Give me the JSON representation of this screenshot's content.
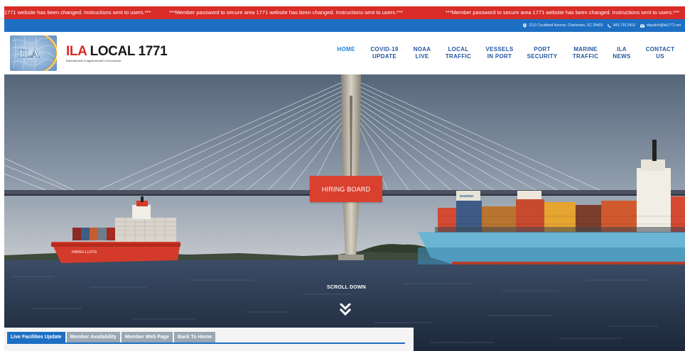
{
  "ticker": {
    "segments": [
      "1771 website has been changed. Instructions sent to users.***",
      "***Member password to secure area 1771 website has been changed. Instructions sent to users.***",
      "***Member password to secure area 1771 website has been changed. Instructions sent to users.***"
    ]
  },
  "topbar": {
    "address": "2113 Courtland Avenue, Charleston, SC 29403",
    "phone": "843.723.2410",
    "email": "dispatch@ila1771.net"
  },
  "brand": {
    "ila": "ILA",
    "local": "LOCAL 1771",
    "subtitle": "International Longshoremen's Association"
  },
  "nav": [
    {
      "label": "HOME",
      "active": true
    },
    {
      "label": "COVID-19\nUPDATE"
    },
    {
      "label": "NOAA\nLIVE"
    },
    {
      "label": "LOCAL\nTRAFFIC"
    },
    {
      "label": "VESSELS\nIN PORT"
    },
    {
      "label": "PORT\nSECURITY"
    },
    {
      "label": "MARINE\nTRAFFIC"
    },
    {
      "label": "ILA\nNEWS"
    },
    {
      "label": "CONTACT\nUS"
    }
  ],
  "hero": {
    "button": "HIRING BOARD",
    "scroll": "SCROLL DOWN",
    "container_label": "MAERSK",
    "ship_label": "HAPAG-LLOYD"
  },
  "tabs": [
    {
      "label": "Live Facilities Update",
      "active": true
    },
    {
      "label": "Member Availability"
    },
    {
      "label": "Member Web Page"
    },
    {
      "label": "Back To Home"
    }
  ],
  "colors": {
    "brand_red": "#d92b27",
    "brand_blue": "#1d6fc4",
    "nav_blue": "#2457a0",
    "button_red": "#d9402e"
  }
}
